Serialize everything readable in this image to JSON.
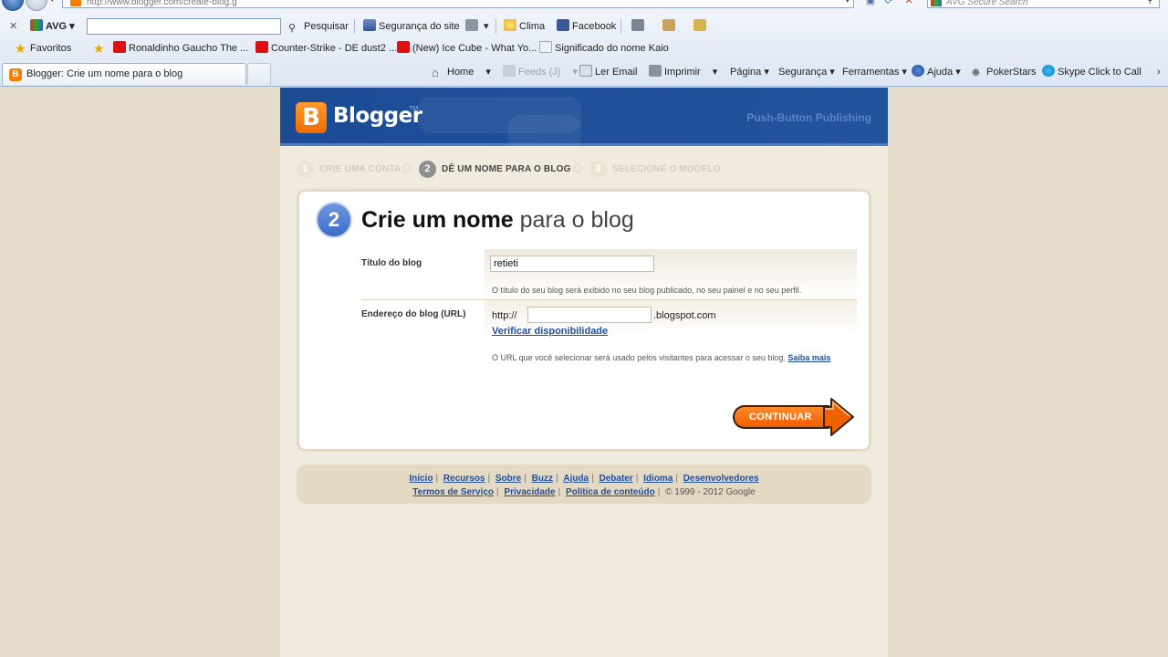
{
  "browser": {
    "address": "http://www.blogger.com/create-blog.g",
    "search_placeholder": "AVG Secure Search",
    "avg_toolbar": {
      "brand": "AVG",
      "search_button": "Pesquisar",
      "site_safety": "Segurança do site",
      "weather": "Clima",
      "facebook": "Facebook"
    },
    "favorites": {
      "label": "Favoritos",
      "items": [
        "Ronaldinho Gaucho  The ...",
        "Counter-Strike - DE dust2 ...",
        "(New) Ice Cube - What Yo...",
        "Significado do nome Kaio"
      ]
    },
    "tab": {
      "title": "Blogger: Crie um nome para o blog"
    },
    "commands": {
      "home": "Home",
      "feeds": "Feeds (J)",
      "read_mail": "Ler Email",
      "print": "Imprimir",
      "page": "Página",
      "security": "Segurança",
      "tools": "Ferramentas",
      "help": "Ajuda",
      "pokerstars": "PokerStars",
      "skype": "Skype Click to Call"
    }
  },
  "blogger": {
    "logo": "Blogger",
    "logo_tm": "TM",
    "tagline": "Push-Button Publishing",
    "steps": [
      {
        "num": "1",
        "label": "CRIE UMA CONTA"
      },
      {
        "num": "2",
        "label": "DÊ UM NOME PARA O BLOG"
      },
      {
        "num": "3",
        "label": "SELECIONE O MODELO"
      }
    ],
    "card": {
      "num": "2",
      "title_strong": "Crie um nome",
      "title_light": "para o blog",
      "title_field_label": "Título do blog",
      "title_value": "retieti",
      "title_hint": "O título do seu blog será exibido no seu blog publicado, no seu painel e no seu perfil.",
      "url_field_label": "Endereço do blog (URL)",
      "url_prefix": "http://",
      "url_value": "",
      "url_suffix": ".blogspot.com",
      "verify_link": "Verificar disponibilidade",
      "url_hint": "O URL que você selecionar será usado pelos visitantes para acessar o seu blog.",
      "learn_more": "Saiba mais",
      "continue_button": "CONTINUAR"
    },
    "footer": {
      "links_row1": [
        "Início",
        "Recursos",
        "Sobre",
        "Buzz",
        "Ajuda",
        "Debater",
        "Idioma",
        "Desenvolvedores"
      ],
      "links_row2": [
        "Termos de Serviço",
        "Privacidade",
        "Política de conteúdo"
      ],
      "copyright": "© 1999 - 2012 Google"
    }
  },
  "colors": {
    "brand_orange": "#f57d00",
    "header_blue": "#1e4f98",
    "link_blue": "#1f4f9a"
  }
}
